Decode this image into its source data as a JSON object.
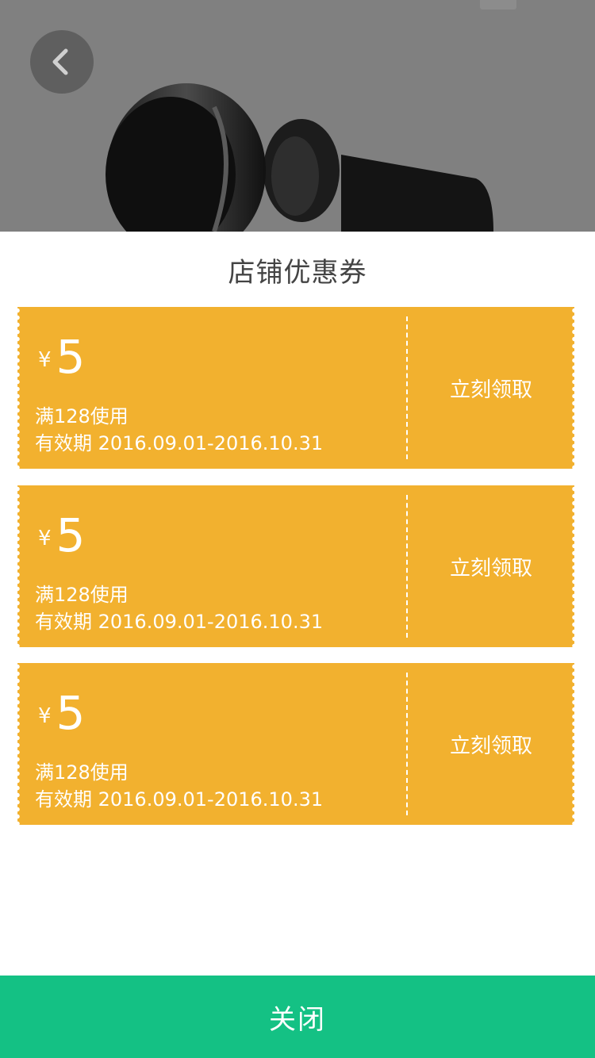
{
  "header": {
    "back_icon": "chevron-left-icon"
  },
  "sheet": {
    "title": "店铺优惠券",
    "coupons": [
      {
        "currency": "¥",
        "amount": "5",
        "condition": "满128使用",
        "validity": "有效期 2016.09.01-2016.10.31",
        "claim_label": "立刻领取"
      },
      {
        "currency": "¥",
        "amount": "5",
        "condition": "满128使用",
        "validity": "有效期 2016.09.01-2016.10.31",
        "claim_label": "立刻领取"
      },
      {
        "currency": "¥",
        "amount": "5",
        "condition": "满128使用",
        "validity": "有效期 2016.09.01-2016.10.31",
        "claim_label": "立刻领取"
      }
    ],
    "close_label": "关闭"
  },
  "colors": {
    "coupon_bg": "#f2b12f",
    "close_bg": "#14c184",
    "overlay": "#808080",
    "title_text": "#444444"
  }
}
